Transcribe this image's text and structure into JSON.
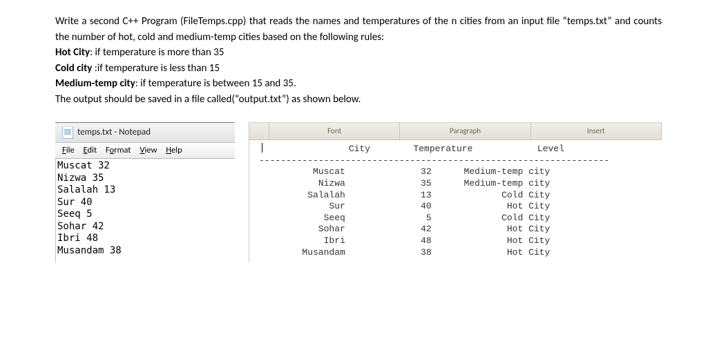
{
  "instructions": {
    "p1": "Write a second C++ Program (FileTemps.cpp) that reads the names and temperatures of the n cities from an input file “temps.txt” and counts the number of hot, cold and medium-temp cities based on the following rules:",
    "hot_label": "Hot City",
    "hot_rule": ": if temperature is more than 35",
    "cold_label": "Cold city ",
    "cold_rule": ":if temperature is less than 15",
    "med_label": "Medium-temp city",
    "med_rule": ": if temperature is between 15 and 35.",
    "out_line": "The output should be saved in a file called(“output.txt”) as shown  below."
  },
  "notepad": {
    "title": "temps.txt - Notepad",
    "menu": {
      "file": "File",
      "edit": "Edit",
      "format": "Format",
      "view": "View",
      "help": "Help"
    },
    "lines": [
      "Muscat 32",
      "Nizwa 35",
      "Salalah 13",
      "Sur 40",
      "Seeq 5",
      "Sohar 42",
      "Ibri 48",
      "Musandam 38"
    ]
  },
  "ribbon": {
    "font": "Font",
    "paragraph": "Paragraph",
    "insert": "Insert"
  },
  "output": {
    "hdr_city": "City",
    "hdr_temp": "Temperature",
    "hdr_level": "Level",
    "sep": "-----------------------------------------------------------------",
    "rows": [
      {
        "city": "Muscat",
        "temp": "32",
        "level": "Medium-temp city"
      },
      {
        "city": "Nizwa",
        "temp": "35",
        "level": "Medium-temp city"
      },
      {
        "city": "Salalah",
        "temp": "13",
        "level": "Cold City"
      },
      {
        "city": "Sur",
        "temp": "40",
        "level": "Hot City"
      },
      {
        "city": "Seeq",
        "temp": "5",
        "level": "Cold City"
      },
      {
        "city": "Sohar",
        "temp": "42",
        "level": "Hot City"
      },
      {
        "city": "Ibri",
        "temp": "48",
        "level": "Hot City"
      },
      {
        "city": "Musandam",
        "temp": "38",
        "level": "Hot City"
      }
    ]
  }
}
